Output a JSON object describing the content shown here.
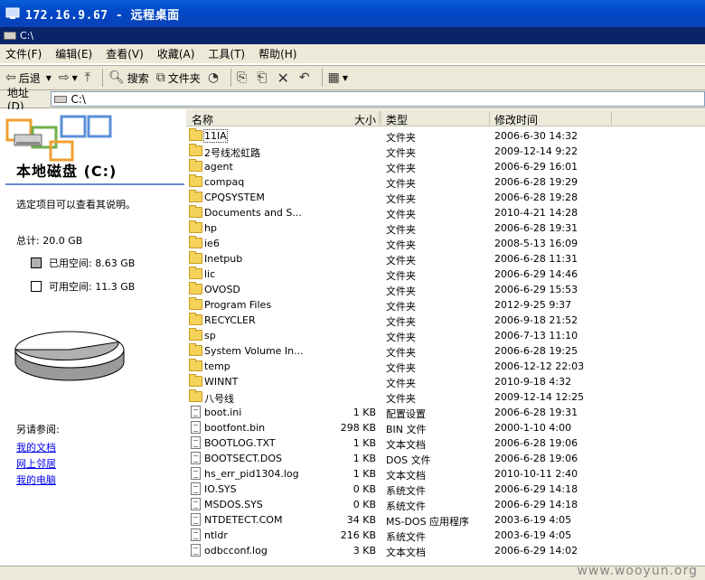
{
  "rdp": {
    "title": "172.16.9.67 - 远程桌面"
  },
  "window": {
    "title": "C:\\"
  },
  "menu": [
    "文件(F)",
    "编辑(E)",
    "查看(V)",
    "收藏(A)",
    "工具(T)",
    "帮助(H)"
  ],
  "toolbar": {
    "back": "后退",
    "search": "搜索",
    "folders": "文件夹"
  },
  "address": {
    "label": "地址(D)",
    "value": "C:\\"
  },
  "left": {
    "drive_title": "本地磁盘 (C:)",
    "hint": "选定项目可以查看其说明。",
    "total": "总计: 20.0 GB",
    "used": "已用空间: 8.63 GB",
    "free": "可用空间: 11.3 GB",
    "used_fraction": 0.43,
    "see_also": "另请参阅:",
    "links": [
      "我的文档",
      "网上邻居",
      "我的电脑"
    ]
  },
  "colors": {
    "titlebar": "#0048c8",
    "selection": "#0a246a",
    "pie_used": "#b0b0b0",
    "pie_free": "#ffffff"
  },
  "columns": {
    "name": "名称",
    "size": "大小",
    "type": "类型",
    "modified": "修改时间"
  },
  "files": [
    {
      "name": "11IA",
      "size": "",
      "type": "文件夹",
      "modified": "2006-6-30 14:32",
      "icon": "folder",
      "selected": true
    },
    {
      "name": "2号线凇虹路",
      "size": "",
      "type": "文件夹",
      "modified": "2009-12-14 9:22",
      "icon": "folder"
    },
    {
      "name": "agent",
      "size": "",
      "type": "文件夹",
      "modified": "2006-6-29 16:01",
      "icon": "folder"
    },
    {
      "name": "compaq",
      "size": "",
      "type": "文件夹",
      "modified": "2006-6-28 19:29",
      "icon": "folder"
    },
    {
      "name": "CPQSYSTEM",
      "size": "",
      "type": "文件夹",
      "modified": "2006-6-28 19:28",
      "icon": "folder"
    },
    {
      "name": "Documents and S...",
      "size": "",
      "type": "文件夹",
      "modified": "2010-4-21 14:28",
      "icon": "folder"
    },
    {
      "name": "hp",
      "size": "",
      "type": "文件夹",
      "modified": "2006-6-28 19:31",
      "icon": "folder"
    },
    {
      "name": "ie6",
      "size": "",
      "type": "文件夹",
      "modified": "2008-5-13 16:09",
      "icon": "folder"
    },
    {
      "name": "Inetpub",
      "size": "",
      "type": "文件夹",
      "modified": "2006-6-28 11:31",
      "icon": "folder"
    },
    {
      "name": "lic",
      "size": "",
      "type": "文件夹",
      "modified": "2006-6-29 14:46",
      "icon": "folder"
    },
    {
      "name": "OVOSD",
      "size": "",
      "type": "文件夹",
      "modified": "2006-6-29 15:53",
      "icon": "folder"
    },
    {
      "name": "Program Files",
      "size": "",
      "type": "文件夹",
      "modified": "2012-9-25 9:37",
      "icon": "folder"
    },
    {
      "name": "RECYCLER",
      "size": "",
      "type": "文件夹",
      "modified": "2006-9-18 21:52",
      "icon": "folder"
    },
    {
      "name": "sp",
      "size": "",
      "type": "文件夹",
      "modified": "2006-7-13 11:10",
      "icon": "folder"
    },
    {
      "name": "System Volume In...",
      "size": "",
      "type": "文件夹",
      "modified": "2006-6-28 19:25",
      "icon": "folder"
    },
    {
      "name": "temp",
      "size": "",
      "type": "文件夹",
      "modified": "2006-12-12 22:03",
      "icon": "folder"
    },
    {
      "name": "WINNT",
      "size": "",
      "type": "文件夹",
      "modified": "2010-9-18 4:32",
      "icon": "folder"
    },
    {
      "name": "八号线",
      "size": "",
      "type": "文件夹",
      "modified": "2009-12-14 12:25",
      "icon": "folder"
    },
    {
      "name": "boot.ini",
      "size": "1 KB",
      "type": "配置设置",
      "modified": "2006-6-28 19:31",
      "icon": "file"
    },
    {
      "name": "bootfont.bin",
      "size": "298 KB",
      "type": "BIN 文件",
      "modified": "2000-1-10 4:00",
      "icon": "file"
    },
    {
      "name": "BOOTLOG.TXT",
      "size": "1 KB",
      "type": "文本文档",
      "modified": "2006-6-28 19:06",
      "icon": "file"
    },
    {
      "name": "BOOTSECT.DOS",
      "size": "1 KB",
      "type": "DOS 文件",
      "modified": "2006-6-28 19:06",
      "icon": "file"
    },
    {
      "name": "hs_err_pid1304.log",
      "size": "1 KB",
      "type": "文本文档",
      "modified": "2010-10-11 2:40",
      "icon": "file"
    },
    {
      "name": "IO.SYS",
      "size": "0 KB",
      "type": "系统文件",
      "modified": "2006-6-29 14:18",
      "icon": "file"
    },
    {
      "name": "MSDOS.SYS",
      "size": "0 KB",
      "type": "系统文件",
      "modified": "2006-6-29 14:18",
      "icon": "file"
    },
    {
      "name": "NTDETECT.COM",
      "size": "34 KB",
      "type": "MS-DOS 应用程序",
      "modified": "2003-6-19 4:05",
      "icon": "file"
    },
    {
      "name": "ntldr",
      "size": "216 KB",
      "type": "系统文件",
      "modified": "2003-6-19 4:05",
      "icon": "file"
    },
    {
      "name": "odbcconf.log",
      "size": "3 KB",
      "type": "文本文档",
      "modified": "2006-6-29 14:02",
      "icon": "file"
    }
  ],
  "watermark": "www.wooyun.org"
}
